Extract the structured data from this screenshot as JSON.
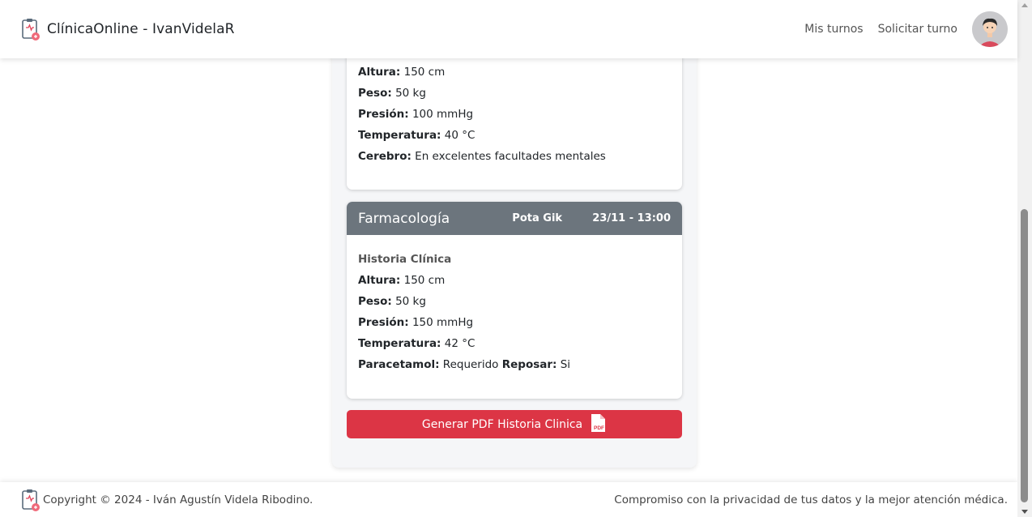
{
  "navbar": {
    "brand": "ClínicaOnline - IvanVidelaR",
    "links": [
      "Mis turnos",
      "Solicitar turno"
    ]
  },
  "card1": {
    "rows": [
      {
        "label": "Altura:",
        "value": "150 cm"
      },
      {
        "label": "Peso:",
        "value": "50 kg"
      },
      {
        "label": "Presión:",
        "value": "100 mmHg"
      },
      {
        "label": "Temperatura:",
        "value": "40 °C"
      },
      {
        "label": "Cerebro:",
        "value": "En excelentes facultades mentales"
      }
    ]
  },
  "card2": {
    "specialty": "Farmacología",
    "doctor": "Pota Gik",
    "datetime": "23/11 - 13:00",
    "section_title": "Historia Clínica",
    "rows": [
      {
        "label": "Altura:",
        "value": "150 cm"
      },
      {
        "label": "Peso:",
        "value": "50 kg"
      },
      {
        "label": "Presión:",
        "value": "150 mmHg"
      },
      {
        "label": "Temperatura:",
        "value": "42 °C"
      }
    ],
    "extra": {
      "label1": "Paracetamol:",
      "value1": "Requerido",
      "label2": "Reposar:",
      "value2": "Si"
    }
  },
  "pdf_button": {
    "label": "Generar PDF Historia Clinica",
    "icon": "pdf-file-icon",
    "color": "#dc3545"
  },
  "footer": {
    "copyright": "Copyright © 2024 - Iván Agustín Videla Ribodino.",
    "tagline": "Compromiso con la privacidad de tus datos y la mejor atención médica."
  },
  "colors": {
    "card_header": "#6c757d",
    "accent": "#dc3545"
  }
}
